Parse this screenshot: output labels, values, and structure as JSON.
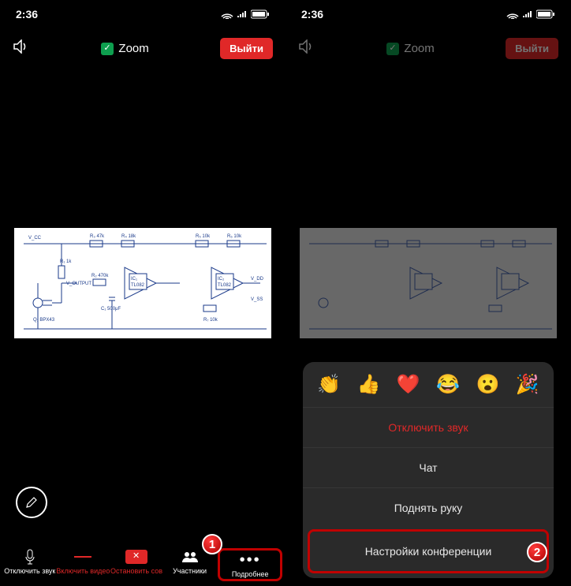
{
  "status": {
    "time": "2:36"
  },
  "top": {
    "title": "Zoom",
    "leave": "Выйти"
  },
  "bottom": {
    "mute": "Отключить звук",
    "video": "Включить видео",
    "stop": "Остановить сов",
    "participants": "Участники",
    "more": "Подробнее"
  },
  "popup": {
    "emojis": [
      "👏",
      "👍",
      "❤️",
      "😂",
      "😮",
      "🎉"
    ],
    "mute": "Отключить звук",
    "chat": "Чат",
    "raise": "Поднять руку",
    "settings": "Настройки конференции"
  },
  "badges": {
    "one": "1",
    "two": "2"
  }
}
